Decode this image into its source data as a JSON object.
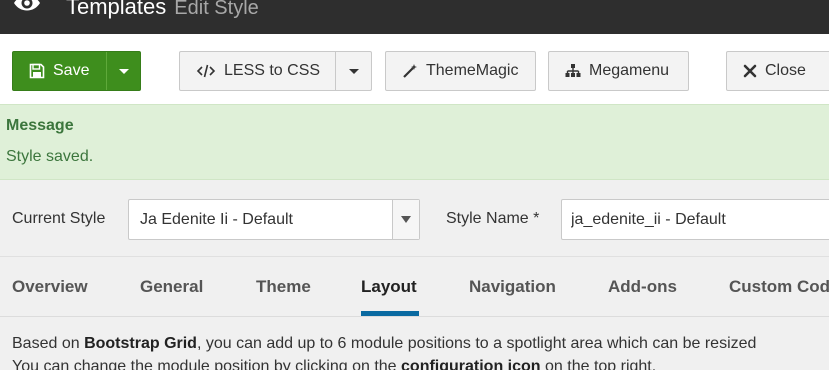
{
  "header": {
    "title": "Templates",
    "subtitle": "Edit Style",
    "icon": "eye-icon"
  },
  "toolbar": {
    "save_label": "Save",
    "less_label": "LESS to CSS",
    "thememagic_label": "ThemeMagic",
    "megamenu_label": "Megamenu",
    "close_label": "Close",
    "save_color": "#3e8e1d"
  },
  "message": {
    "heading": "Message",
    "text": "Style saved.",
    "background": "#dff0d8",
    "text_color": "#3c763d"
  },
  "style_form": {
    "current_style_label": "Current Style",
    "current_style_value": "Ja Edenite Ii - Default",
    "style_name_label": "Style Name *",
    "style_name_value": "ja_edenite_ii - Default"
  },
  "tabs": [
    {
      "label": "Overview",
      "active": false
    },
    {
      "label": "General",
      "active": false
    },
    {
      "label": "Theme",
      "active": false
    },
    {
      "label": "Layout",
      "active": true
    },
    {
      "label": "Navigation",
      "active": false
    },
    {
      "label": "Add-ons",
      "active": false
    },
    {
      "label": "Custom Code",
      "active": false
    }
  ],
  "active_tab_color": "#0a6aa1",
  "description": {
    "line1_pre": "Based on ",
    "line1_bold": "Bootstrap Grid",
    "line1_post": ", you can add up to 6 module positions to a spotlight area which can be resized",
    "line2_pre": "You can change the module position by clicking on the ",
    "line2_bold": "configuration icon",
    "line2_post": " on the top right."
  }
}
